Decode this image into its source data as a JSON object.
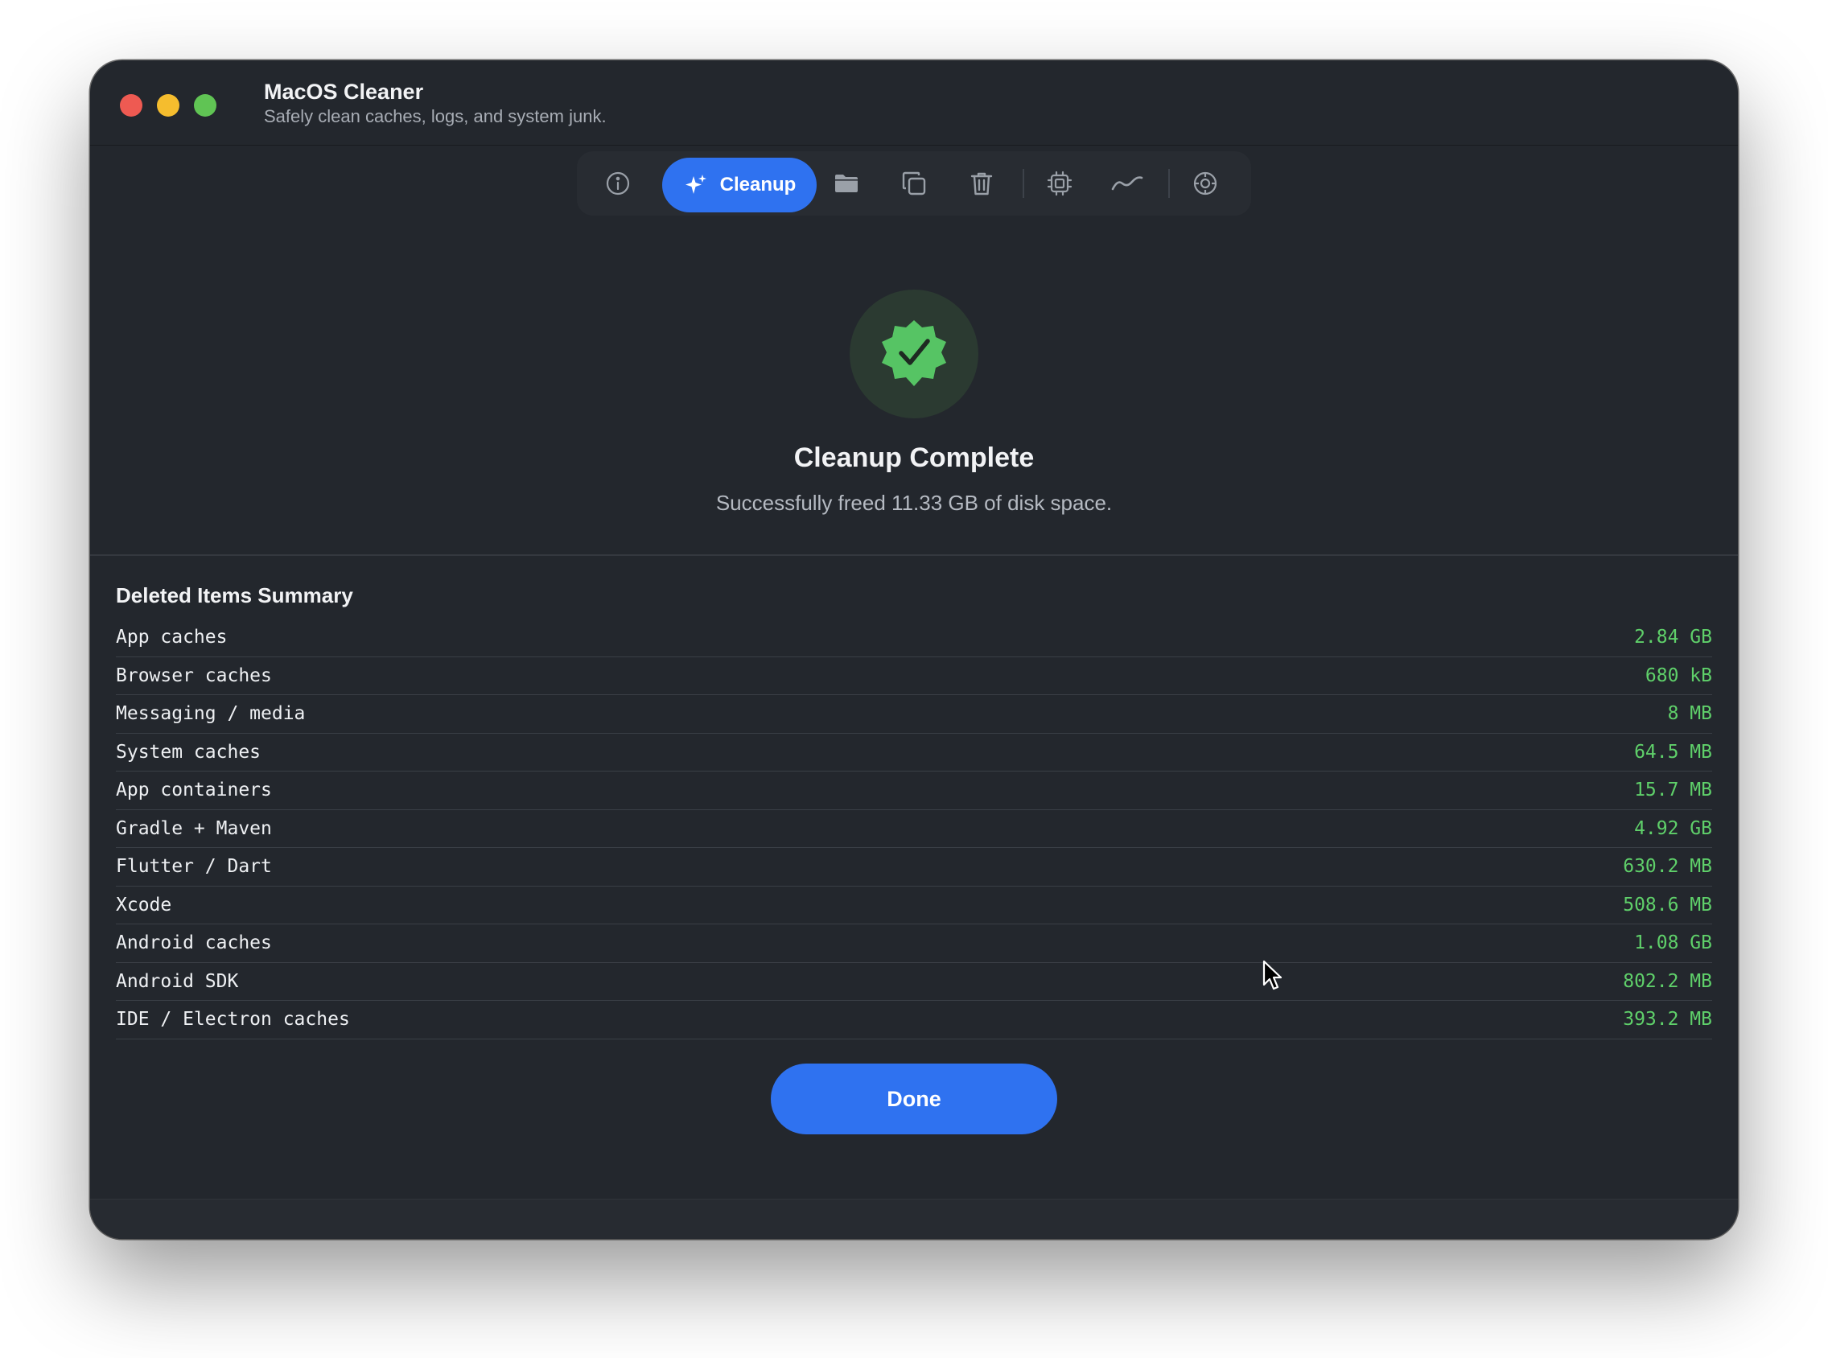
{
  "app": {
    "title": "MacOS Cleaner",
    "subtitle": "Safely clean caches, logs, and system junk."
  },
  "toolbar": {
    "active_label": "Cleanup",
    "items": [
      {
        "icon": "gauge-icon",
        "active": false
      },
      {
        "icon": "sparkles-icon",
        "label": "Cleanup",
        "active": true
      },
      {
        "icon": "folder-icon",
        "active": false
      },
      {
        "icon": "duplicate-icon",
        "active": false
      },
      {
        "icon": "trash-icon",
        "active": false
      },
      {
        "icon": "cpu-icon",
        "active": false
      },
      {
        "icon": "activity-icon",
        "active": false
      },
      {
        "icon": "settings-icon",
        "active": false
      }
    ]
  },
  "result": {
    "title": "Cleanup Complete",
    "message": "Successfully freed 11.33 GB of disk space."
  },
  "summary": {
    "title": "Deleted Items Summary",
    "items": [
      {
        "name": "App caches",
        "size": "2.84 GB"
      },
      {
        "name": "Browser caches",
        "size": "680 kB"
      },
      {
        "name": "Messaging / media",
        "size": "8 MB"
      },
      {
        "name": "System caches",
        "size": "64.5 MB"
      },
      {
        "name": "App containers",
        "size": "15.7 MB"
      },
      {
        "name": "Gradle + Maven",
        "size": "4.92 GB"
      },
      {
        "name": "Flutter / Dart",
        "size": "630.2 MB"
      },
      {
        "name": "Xcode",
        "size": "508.6 MB"
      },
      {
        "name": "Android caches",
        "size": "1.08 GB"
      },
      {
        "name": "Android SDK",
        "size": "802.2 MB"
      },
      {
        "name": "IDE / Electron caches",
        "size": "393.2 MB"
      }
    ]
  },
  "done_button": "Done",
  "colors": {
    "accent": "#2f72f0",
    "success": "#5fd06a",
    "background": "#23272d"
  }
}
